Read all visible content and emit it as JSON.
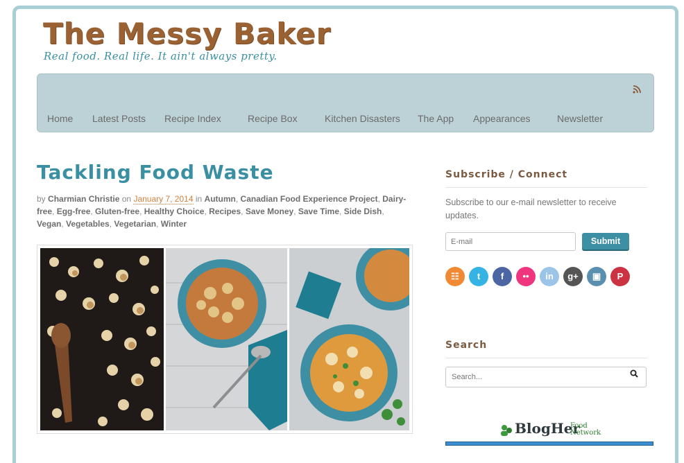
{
  "site": {
    "title": "The Messy Baker",
    "tagline": "Real food. Real life. It ain't always pretty."
  },
  "nav": {
    "rss_icon": "rss-icon",
    "items": [
      {
        "label": "Home"
      },
      {
        "label": "Latest Posts"
      },
      {
        "label": "Recipe Index"
      },
      {
        "label": "Recipe Box"
      },
      {
        "label": "Kitchen Disasters"
      },
      {
        "label": "The App"
      },
      {
        "label": "Appearances"
      },
      {
        "label": "Newsletter"
      }
    ]
  },
  "post": {
    "title": "Tackling Food Waste",
    "by": "by",
    "author": "Charmian Christie",
    "on": "on",
    "date": "January 7, 2014",
    "in": "in",
    "categories": [
      "Autumn",
      "Canadian Food Experience Project",
      "Dairy-free",
      "Egg-free",
      "Gluten-free",
      "Healthy Choice",
      "Recipes",
      "Save Money",
      "Save Time",
      "Side Dish",
      "Vegan",
      "Vegetables",
      "Vegetarian",
      "Winter"
    ]
  },
  "sidebar": {
    "subscribe_heading": "Subscribe / Connect",
    "subscribe_text": "Subscribe to our e-mail newsletter to receive updates.",
    "email_placeholder": "E-mail",
    "submit_label": "Submit",
    "social": [
      {
        "icon": "rss-icon",
        "glyph": "☷",
        "color": "#f08a34"
      },
      {
        "icon": "twitter-icon",
        "glyph": "t",
        "color": "#35b3e5"
      },
      {
        "icon": "facebook-icon",
        "glyph": "f",
        "color": "#4c66a4"
      },
      {
        "icon": "flickr-icon",
        "glyph": "••",
        "color": "#f0357f"
      },
      {
        "icon": "linkedin-icon",
        "glyph": "in",
        "color": "#9bc4e8"
      },
      {
        "icon": "google-plus-icon",
        "glyph": "g+",
        "color": "#555555"
      },
      {
        "icon": "instagram-icon",
        "glyph": "▣",
        "color": "#5a8fb0"
      },
      {
        "icon": "pinterest-icon",
        "glyph": "P",
        "color": "#cc3342"
      }
    ],
    "search_heading": "Search",
    "search_placeholder": "Search...",
    "blogher_brand": "BlogHer",
    "blogher_sub1": "Food",
    "blogher_sub2": "Network"
  },
  "colors": {
    "title_brown": "#9a6133",
    "teal": "#3a8fa3",
    "nav_bg": "#bdd2d6",
    "frame": "#a9cfd6"
  }
}
